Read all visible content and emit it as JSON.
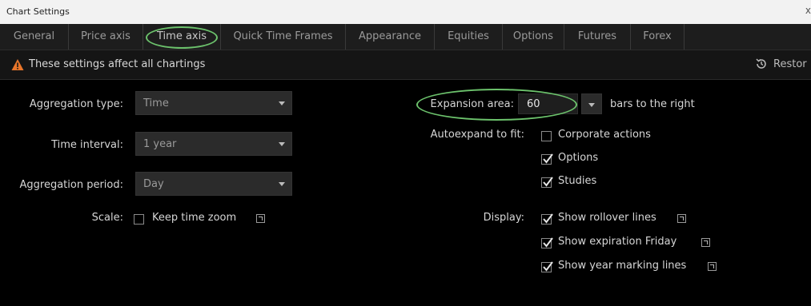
{
  "window": {
    "title": "Chart Settings",
    "close": "x"
  },
  "tabs": [
    {
      "label": "General"
    },
    {
      "label": "Price axis"
    },
    {
      "label": "Time axis"
    },
    {
      "label": "Quick Time Frames"
    },
    {
      "label": "Appearance"
    },
    {
      "label": "Equities"
    },
    {
      "label": "Options"
    },
    {
      "label": "Futures"
    },
    {
      "label": "Forex"
    }
  ],
  "active_tab": "Time axis",
  "notice": {
    "message": "These settings affect all chartings",
    "restore_label": "Restor"
  },
  "left": {
    "aggregation_type": {
      "label": "Aggregation type:",
      "value": "Time"
    },
    "time_interval": {
      "label": "Time interval:",
      "value": "1 year"
    },
    "aggregation_period": {
      "label": "Aggregation period:",
      "value": "Day"
    },
    "scale": {
      "label": "Scale:",
      "keep_time_zoom": {
        "label": "Keep time zoom",
        "checked": false
      }
    }
  },
  "right": {
    "expansion": {
      "label": "Expansion area:",
      "value": "60",
      "suffix": "bars to the right"
    },
    "autoexpand": {
      "label": "Autoexpand to fit:",
      "corporate_actions": {
        "label": "Corporate actions",
        "checked": false
      },
      "options": {
        "label": "Options",
        "checked": true
      },
      "studies": {
        "label": "Studies",
        "checked": true
      }
    },
    "display": {
      "label": "Display:",
      "rollover": {
        "label": "Show rollover lines",
        "checked": true
      },
      "expiration": {
        "label": "Show expiration Friday",
        "checked": true
      },
      "year_marking": {
        "label": "Show year marking lines",
        "checked": true
      }
    }
  },
  "colors": {
    "highlight_oval": "#6cc26c",
    "warning": "#e8752a"
  }
}
